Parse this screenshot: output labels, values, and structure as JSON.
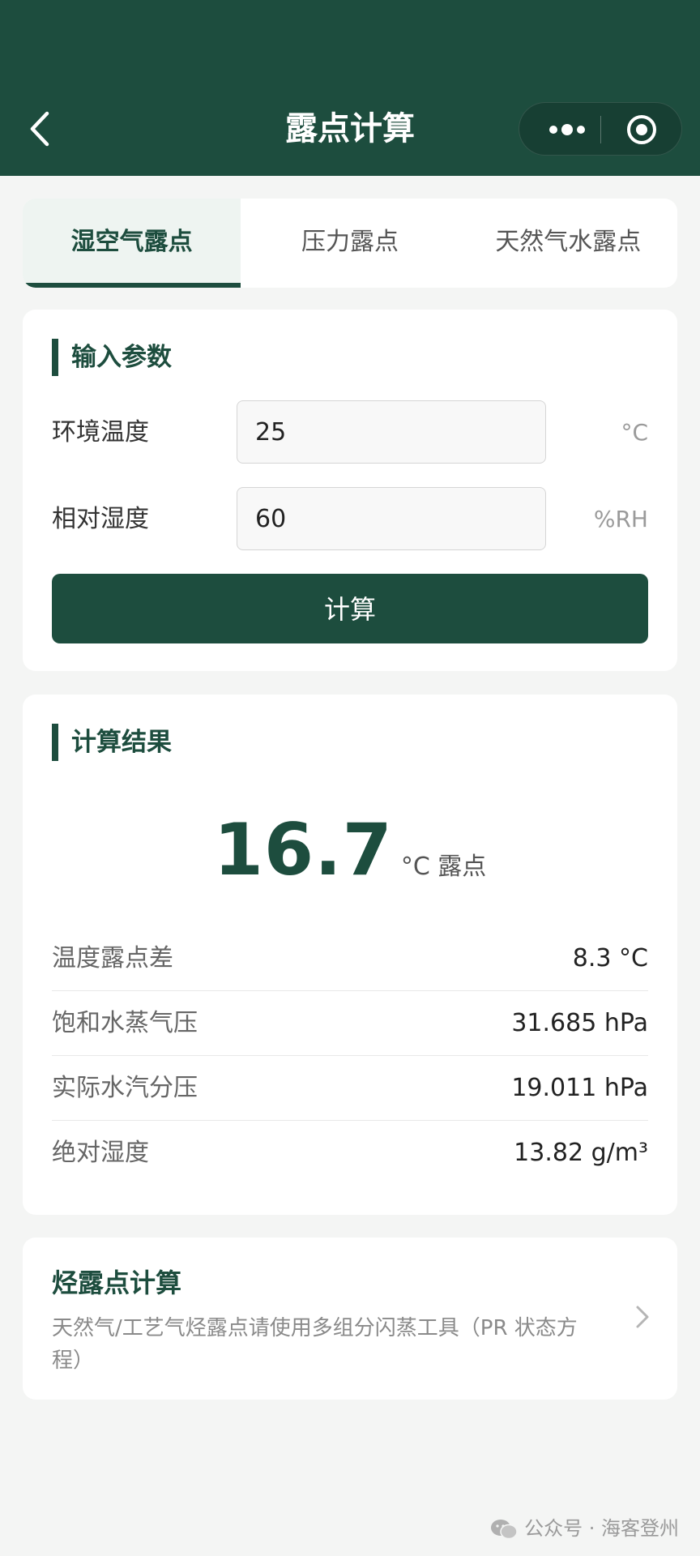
{
  "header": {
    "title": "露点计算",
    "back_icon": "chevron-left-icon",
    "menu_icon": "more-dots-icon",
    "close_icon": "target-circle-icon"
  },
  "tabs": [
    {
      "label": "湿空气露点",
      "active": true
    },
    {
      "label": "压力露点",
      "active": false
    },
    {
      "label": "天然气水露点",
      "active": false
    }
  ],
  "input": {
    "section_title": "输入参数",
    "fields": [
      {
        "label": "环境温度",
        "value": "25",
        "unit": "°C"
      },
      {
        "label": "相对湿度",
        "value": "60",
        "unit": "%RH"
      }
    ],
    "button_label": "计算"
  },
  "result": {
    "section_title": "计算结果",
    "main_value": "16.7",
    "main_unit": "°C 露点",
    "rows": [
      {
        "label": "温度露点差",
        "value": "8.3 °C"
      },
      {
        "label": "饱和水蒸气压",
        "value": "31.685 hPa"
      },
      {
        "label": "实际水汽分压",
        "value": "19.011 hPa"
      },
      {
        "label": "绝对湿度",
        "value": "13.82 g/m³"
      }
    ]
  },
  "hydrocarbon": {
    "title": "烃露点计算",
    "description": "天然气/工艺气烃露点请使用多组分闪蒸工具（PR 状态方程）"
  },
  "footer": {
    "text": "公众号 · 海客登州"
  },
  "colors": {
    "brand": "#1d4d3e",
    "background": "#f4f5f4"
  }
}
